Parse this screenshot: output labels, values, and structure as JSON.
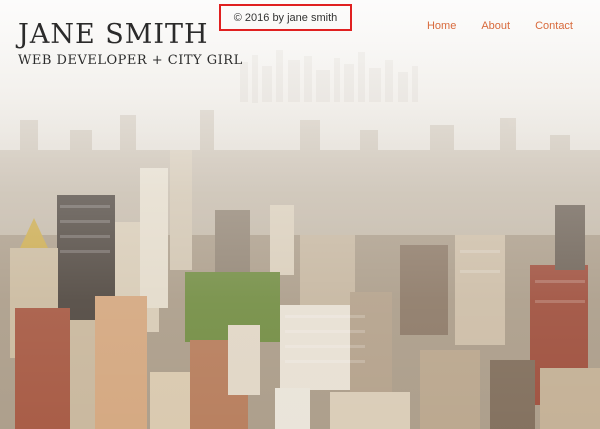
{
  "brand": {
    "name": "JANE SMITH",
    "tagline": "WEB DEVELOPER + CITY GIRL"
  },
  "copyright": {
    "text": "© 2016 by jane smith"
  },
  "nav": {
    "items": [
      "Home",
      "About",
      "Contact"
    ]
  },
  "background": {
    "image": "aerial-city-skyline"
  },
  "colors": {
    "nav_link": "#d86a3c",
    "highlight_border": "#e02020",
    "text": "#2b2b2b"
  }
}
